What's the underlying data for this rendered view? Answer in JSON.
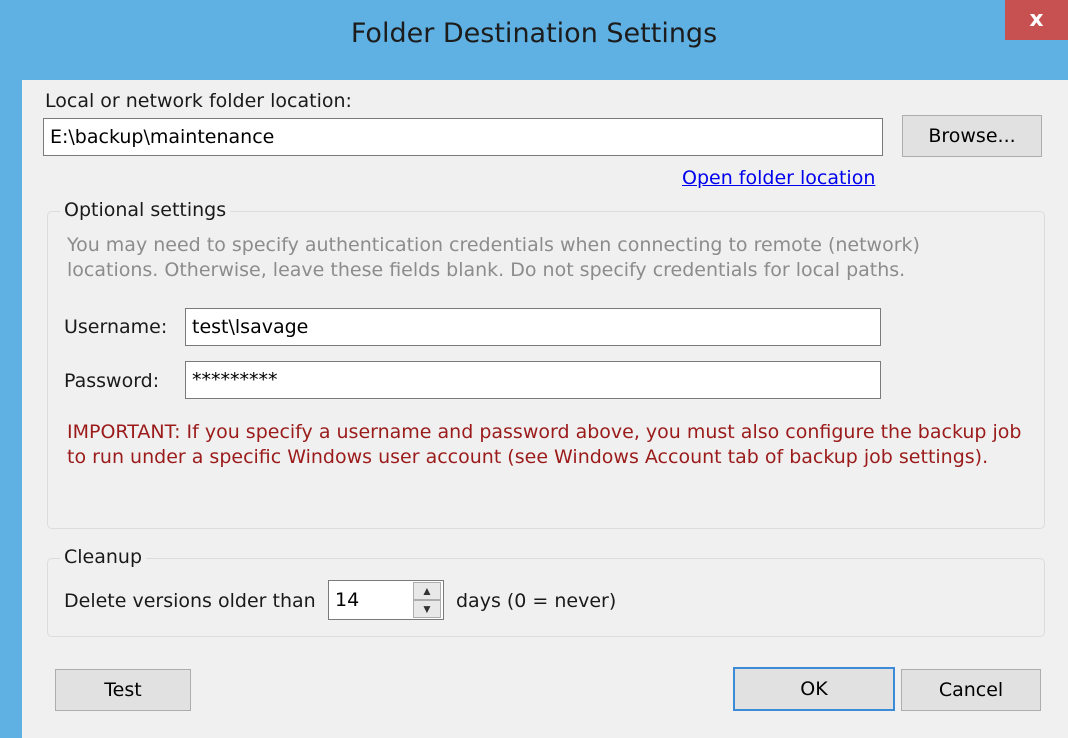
{
  "dialog": {
    "title": "Folder Destination Settings",
    "close_glyph": "x"
  },
  "folder": {
    "label": "Local or network folder location:",
    "value": "E:\\backup\\maintenance",
    "browse_label": "Browse...",
    "open_link": "Open folder location"
  },
  "optional": {
    "title": "Optional settings",
    "info": "You may need to specify authentication credentials when connecting to remote (network) locations. Otherwise, leave these fields blank. Do not specify credentials for local paths.",
    "username_label": "Username:",
    "username_value": "test\\lsavage",
    "password_label": "Password:",
    "password_value": "*********",
    "important": "IMPORTANT: If you specify a username and password above, you must also configure the backup job to run under a specific Windows user account (see Windows Account tab of backup job settings)."
  },
  "cleanup": {
    "title": "Cleanup",
    "prefix": "Delete versions older than",
    "value": "14",
    "suffix": "days (0 = never)"
  },
  "buttons": {
    "test": "Test",
    "ok": "OK",
    "cancel": "Cancel"
  },
  "colors": {
    "titlebar": "#5fb1e3",
    "close": "#c75050",
    "link": "#0000ee",
    "important": "#9b1b1b"
  },
  "icons": {
    "spin_up": "up-arrow-icon",
    "spin_down": "down-arrow-icon"
  }
}
